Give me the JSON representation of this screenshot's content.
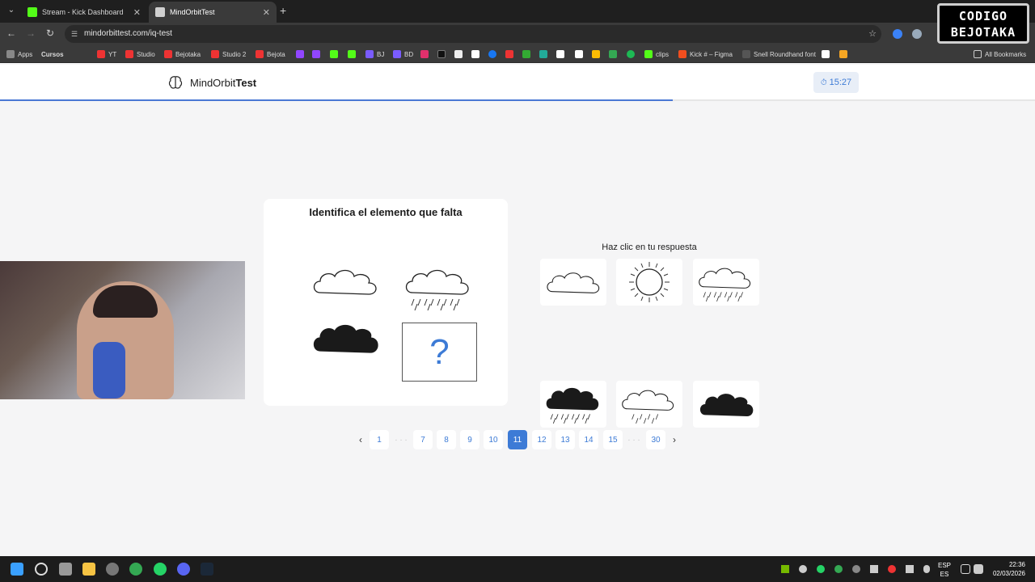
{
  "browser": {
    "tabs": [
      {
        "title": "Stream - Kick Dashboard",
        "favicon_color": "#53fc18"
      },
      {
        "title": "MindOrbitTest",
        "favicon_color": "#d0d0d0"
      }
    ],
    "url": "mindorbittest.com/iq-test",
    "bookmarks": [
      {
        "label": "Apps"
      },
      {
        "label": "Cursos"
      },
      {
        "label": "YT"
      },
      {
        "label": "Studio"
      },
      {
        "label": "Bejotaka"
      },
      {
        "label": "Studio 2"
      },
      {
        "label": "Bejota"
      },
      {
        "label": "BJ"
      },
      {
        "label": "BD"
      },
      {
        "label": "clips"
      },
      {
        "label": "Kick # – Figma"
      },
      {
        "label": "Snell Roundhand font"
      },
      {
        "label": "All Bookmarks"
      }
    ]
  },
  "overlay": {
    "watermark_line1": "CODIGO",
    "watermark_line2": "BEJOTAKA"
  },
  "app": {
    "logo_regular": "MindOrbit",
    "logo_bold": "Test",
    "timer": "15:27",
    "progress_fraction": 0.65,
    "accent": "#3d7bd6"
  },
  "question": {
    "title": "Identifica el elemento que falta",
    "missing_symbol": "?"
  },
  "answers": {
    "label": "Haz clic en tu respuesta",
    "options": [
      {
        "id": "outline-cloud"
      },
      {
        "id": "sun"
      },
      {
        "id": "outline-cloud-rain"
      },
      {
        "id": "filled-cloud-rain"
      },
      {
        "id": "outline-cloud-light-rain"
      },
      {
        "id": "filled-cloud"
      }
    ]
  },
  "pagination": {
    "prev": "‹",
    "next": "›",
    "pages": [
      {
        "label": "1"
      },
      {
        "label": "· · ·"
      },
      {
        "label": "7"
      },
      {
        "label": "8"
      },
      {
        "label": "9"
      },
      {
        "label": "10"
      },
      {
        "label": "11",
        "active": true
      },
      {
        "label": "12"
      },
      {
        "label": "13"
      },
      {
        "label": "14"
      },
      {
        "label": "15"
      },
      {
        "label": "· · ·"
      },
      {
        "label": "30"
      }
    ]
  },
  "taskbar": {
    "lang_top": "ESP",
    "lang_bottom": "ES",
    "time": "22:36",
    "date": "02/03/2026"
  }
}
